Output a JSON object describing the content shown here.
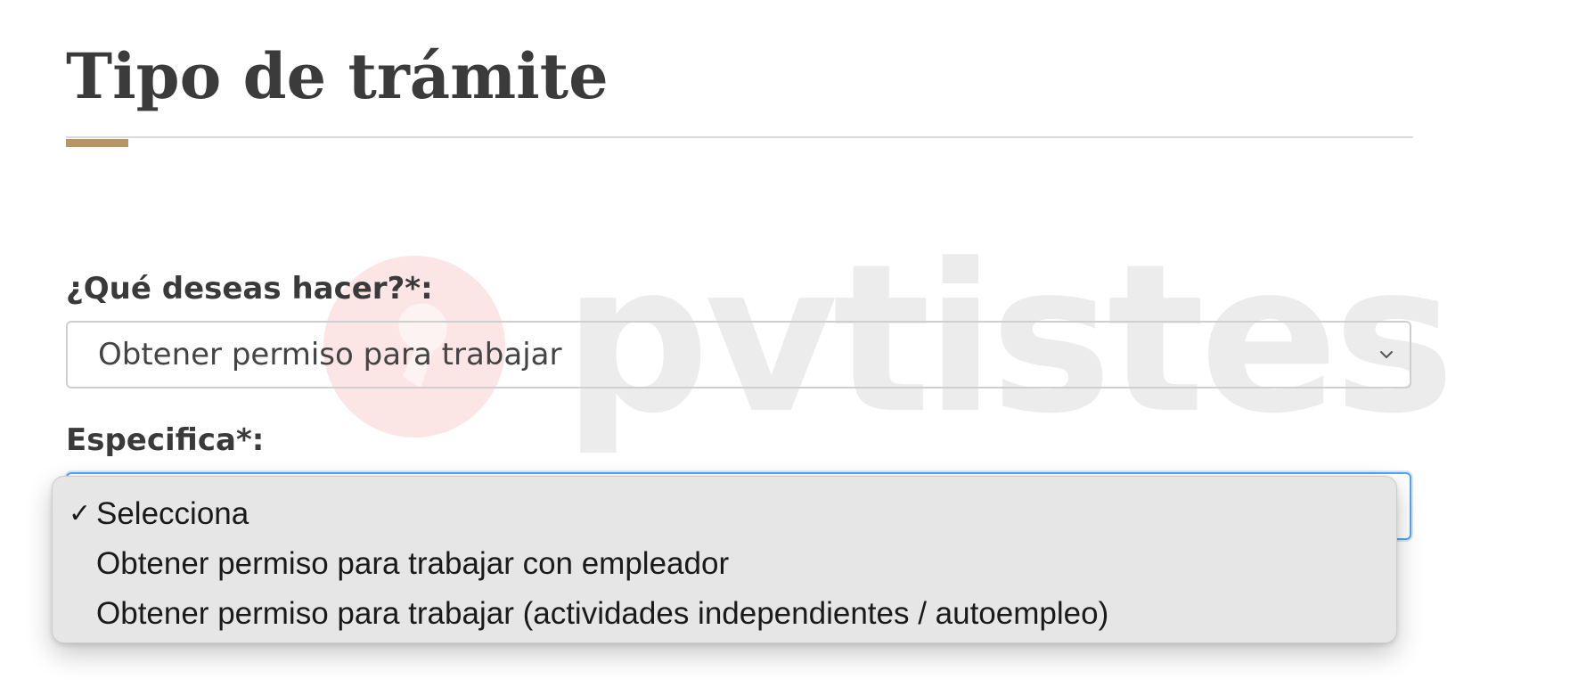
{
  "form": {
    "title": "Tipo de trámite",
    "accent_color": "#b69665",
    "question_1": {
      "label": "¿Qué deseas hacer?*:",
      "selected_value": "Obtener permiso para trabajar"
    },
    "question_2": {
      "label": "Especifica*:",
      "selected_value": "Selecciona",
      "focus_color": "#5aa3e8",
      "options": [
        {
          "label": "Selecciona",
          "checked": true
        },
        {
          "label": "Obtener permiso para trabajar con empleador",
          "checked": false
        },
        {
          "label": "Obtener permiso para trabajar (actividades independientes / autoempleo)",
          "checked": false
        }
      ]
    }
  },
  "watermark": {
    "text": "pvtistes",
    "pin_color": "#f4b5b5"
  },
  "icons": {
    "chevron": "chevron-down-icon",
    "check": "checkmark-icon",
    "watermark_pin": "location-pin-icon"
  }
}
